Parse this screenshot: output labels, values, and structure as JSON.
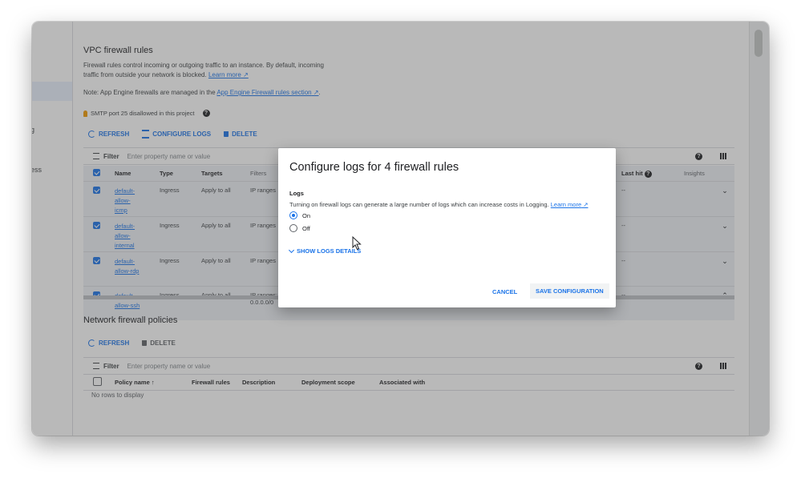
{
  "sidebar": {
    "fragments": [
      "g",
      "ess"
    ]
  },
  "vpc": {
    "title": "VPC firewall rules",
    "description": "Firewall rules control incoming or outgoing traffic to an instance. By default, incoming traffic from outside your network is blocked.",
    "learn_more": "Learn more",
    "note_prefix": "Note: App Engine firewalls are managed in the",
    "note_link": "App Engine Firewall rules section",
    "note_suffix": ".",
    "smtp": "SMTP port 25 disallowed in this project",
    "toolbar": {
      "refresh": "REFRESH",
      "configure_logs": "CONFIGURE LOGS",
      "delete": "DELETE"
    },
    "filter": {
      "label": "Filter",
      "placeholder": "Enter property name or value"
    },
    "columns": {
      "name": "Name",
      "type": "Type",
      "targets": "Targets",
      "filters": "Filters",
      "last_hit": "Last hit",
      "insights": "Insights"
    },
    "rows": [
      {
        "name": [
          "default-",
          "allow-",
          "icmp"
        ],
        "type": "Ingress",
        "targets": "Apply to all",
        "filters": [
          "IP ranges"
        ],
        "last_hit": "--",
        "chevron": "⌄"
      },
      {
        "name": [
          "default-",
          "allow-",
          "internal"
        ],
        "type": "Ingress",
        "targets": "Apply to all",
        "filters": [
          "IP ranges"
        ],
        "last_hit": "--",
        "chevron": "⌄"
      },
      {
        "name": [
          "default-",
          "allow-rdp"
        ],
        "type": "Ingress",
        "targets": "Apply to all",
        "filters": [
          "IP ranges"
        ],
        "last_hit": "--",
        "chevron": "⌄"
      },
      {
        "name": [
          "default-",
          "allow-ssh"
        ],
        "type": "Ingress",
        "targets": "Apply to all",
        "filters": [
          "IP ranges:",
          "0.0.0.0/0"
        ],
        "last_hit": "--",
        "chevron": "⌃"
      }
    ]
  },
  "nfp": {
    "title": "Network firewall policies",
    "toolbar": {
      "refresh": "REFRESH",
      "delete": "DELETE"
    },
    "filter": {
      "label": "Filter",
      "placeholder": "Enter property name or value"
    },
    "columns": {
      "policy_name": "Policy name",
      "firewall_rules": "Firewall rules",
      "description": "Description",
      "deployment_scope": "Deployment scope",
      "associated_with": "Associated with"
    },
    "empty": "No rows to display"
  },
  "dialog": {
    "title": "Configure logs for 4 firewall rules",
    "logs_label": "Logs",
    "warning": "Turning on firewall logs can generate a large number of logs which can increase costs in Logging.",
    "learn_more": "Learn more",
    "on": "On",
    "off": "Off",
    "show_details": "SHOW LOGS DETAILS",
    "cancel": "CANCEL",
    "save": "SAVE CONFIGURATION"
  },
  "colors": {
    "accent": "#1a73e8",
    "overlay": "rgba(70,70,70,0.38)"
  }
}
